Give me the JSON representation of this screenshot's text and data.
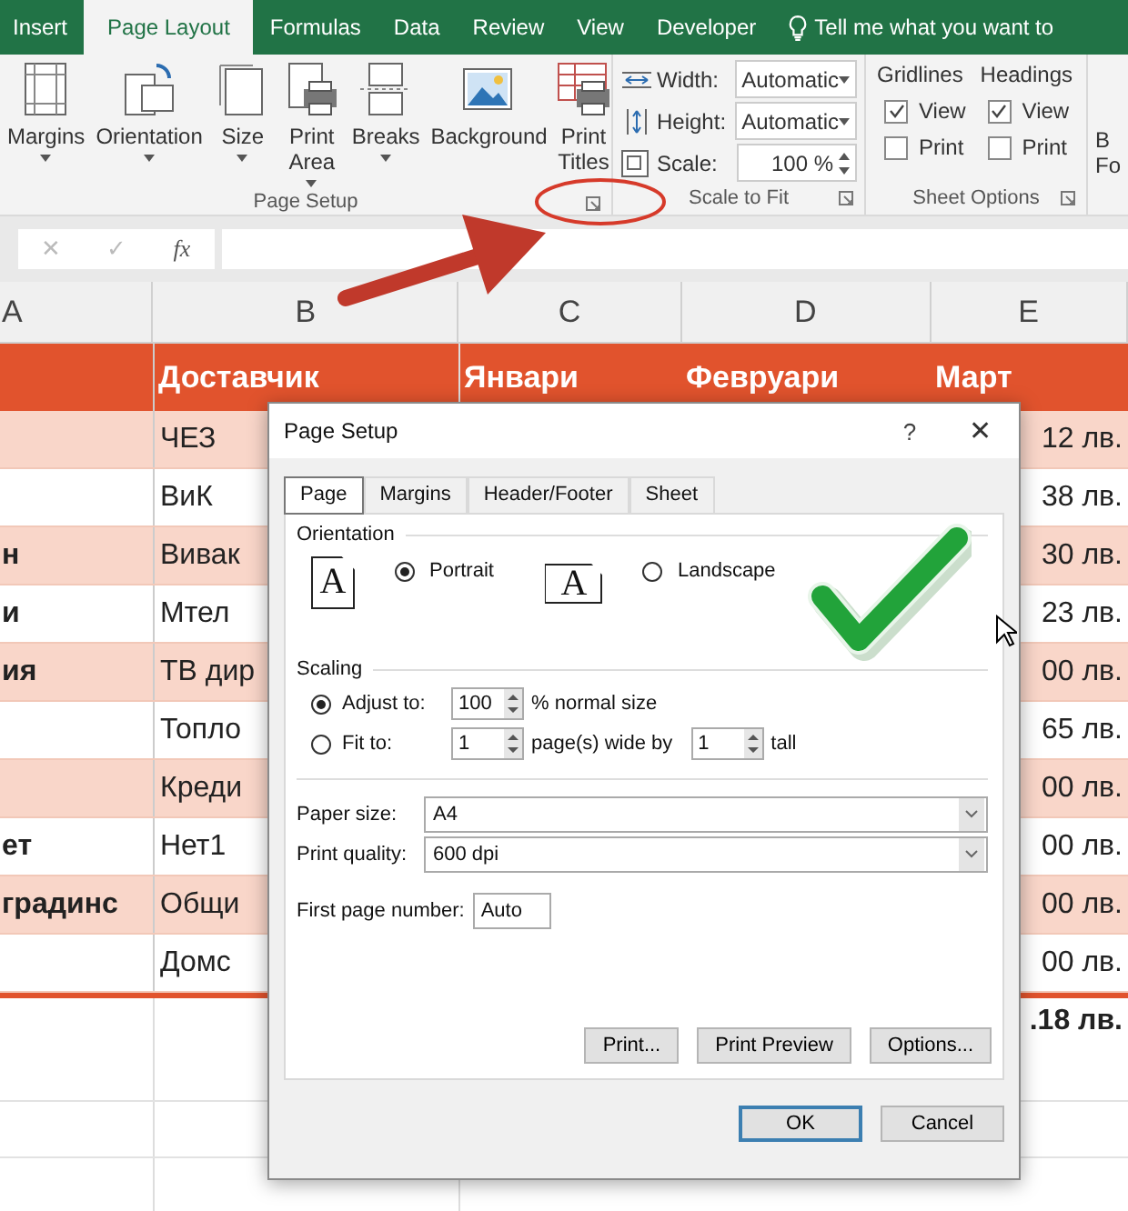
{
  "ribbon_tabs": [
    {
      "label": "Insert",
      "selected": false
    },
    {
      "label": "Page Layout",
      "selected": true
    },
    {
      "label": "Formulas",
      "selected": false
    },
    {
      "label": "Data",
      "selected": false
    },
    {
      "label": "Review",
      "selected": false
    },
    {
      "label": "View",
      "selected": false
    },
    {
      "label": "Developer",
      "selected": false
    }
  ],
  "tell_me": "Tell me what you want to",
  "page_setup_group": {
    "title": "Page Setup",
    "launcher": true,
    "buttons": [
      {
        "label": "Margins",
        "dropdown": true
      },
      {
        "label": "Orientation",
        "dropdown": true
      },
      {
        "label": "Size",
        "dropdown": true
      },
      {
        "label": "Print Area",
        "dropdown": true
      },
      {
        "label": "Breaks",
        "dropdown": true
      },
      {
        "label": "Background",
        "dropdown": false
      },
      {
        "label": "Print Titles",
        "dropdown": false
      }
    ]
  },
  "scale_group": {
    "title": "Scale to Fit",
    "launcher": true,
    "rows": [
      {
        "label": "Width:",
        "value": "Automatic",
        "kind": "dropdown"
      },
      {
        "label": "Height:",
        "value": "Automatic",
        "kind": "dropdown"
      },
      {
        "label": "Scale:",
        "value": "100 %",
        "kind": "spinner"
      }
    ]
  },
  "sheet_options_group": {
    "title": "Sheet Options",
    "launcher": true,
    "columns": [
      {
        "title": "Gridlines",
        "options": [
          {
            "label": "View",
            "checked": true
          },
          {
            "label": "Print",
            "checked": false
          }
        ]
      },
      {
        "title": "Headings",
        "options": [
          {
            "label": "View",
            "checked": true
          },
          {
            "label": "Print",
            "checked": false
          }
        ]
      }
    ]
  },
  "next_group_lines": [
    "B",
    "Fo"
  ],
  "formula_bar": {
    "cancel": "✕",
    "enter": "✓",
    "function": "fx"
  },
  "columns": [
    "A",
    "B",
    "C",
    "D",
    "E"
  ],
  "header_row": {
    "b": "Доставчик",
    "c": "Январи",
    "d": "Февруари",
    "e": "Март"
  },
  "rows": [
    {
      "b": "ЧЕЗ",
      "e": "12 лв."
    },
    {
      "b": "ВиК",
      "e": "38 лв."
    },
    {
      "a": "н",
      "b": "Вивак",
      "e": "30 лв."
    },
    {
      "a": "и",
      "b": "Мтел",
      "e": "23 лв."
    },
    {
      "a": "ия",
      "b": "ТВ дир",
      "e": "00 лв."
    },
    {
      "b": "Топло",
      "e": "65 лв."
    },
    {
      "b": "Креди",
      "e": "00 лв."
    },
    {
      "a": "ет",
      "b": "Нет1",
      "e": "00 лв."
    },
    {
      "a": "градинс",
      "b": "Общи",
      "e": "00 лв."
    },
    {
      "b": "Домс",
      "e": "00 лв."
    }
  ],
  "total_row": {
    "e": ".18 лв."
  },
  "dialog": {
    "title": "Page Setup",
    "help": "?",
    "close": "✕",
    "tabs": [
      {
        "label": "Page",
        "selected": true
      },
      {
        "label": "Margins",
        "selected": false
      },
      {
        "label": "Header/Footer",
        "selected": false
      },
      {
        "label": "Sheet",
        "selected": false
      }
    ],
    "orientation": {
      "title": "Orientation",
      "options": [
        {
          "label": "Portrait",
          "selected": true,
          "glyph": "A",
          "kind": "portrait"
        },
        {
          "label": "Landscape",
          "selected": false,
          "glyph": "A",
          "kind": "landscape"
        }
      ]
    },
    "scaling": {
      "title": "Scaling",
      "options": [
        {
          "label": "Adjust to:",
          "selected": true,
          "value": "100",
          "suffix": "% normal size"
        },
        {
          "label": "Fit to:",
          "selected": false,
          "value": "1",
          "suffix": "page(s) wide by",
          "value2": "1",
          "suffix2": "tall"
        }
      ]
    },
    "selects": [
      {
        "label": "Paper size:",
        "value": "A4"
      },
      {
        "label": "Print quality:",
        "value": "600 dpi"
      }
    ],
    "first_page_number": {
      "label": "First page number:",
      "value": "Auto"
    },
    "buttons": [
      "Print...",
      "Print Preview",
      "Options..."
    ],
    "footer_buttons": [
      {
        "label": "OK",
        "default": true
      },
      {
        "label": "Cancel",
        "default": false
      }
    ]
  }
}
